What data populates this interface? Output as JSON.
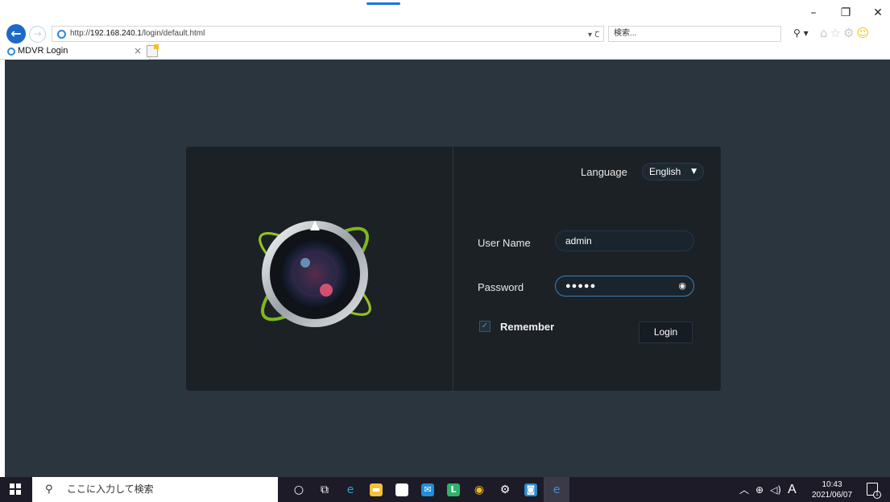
{
  "browser": {
    "window_controls": [
      "–",
      "❐",
      "✕"
    ],
    "back_glyph": "←",
    "forward_glyph": "→",
    "address": {
      "prefix": "http://",
      "host": "192.168.240.1",
      "path": "/login/default.html"
    },
    "address_controls": "▾ Ꞇ",
    "search_placeholder": "検索...",
    "search_icon": "⚲ ▾",
    "toolbar_icons": [
      "⌂",
      "☆",
      "⚙",
      "☺"
    ],
    "tab": {
      "title": "MDVR Login",
      "close": "×"
    }
  },
  "login": {
    "language_label": "Language",
    "language_value": "English",
    "language_caret": "▼",
    "username_label": "User Name",
    "username_value": "admin",
    "password_label": "Password",
    "password_value": "●●●●●",
    "show_password_icon": "eye-icon",
    "remember_label": "Remember",
    "remember_checked": true,
    "remember_check_glyph": "✓",
    "login_label": "Login"
  },
  "taskbar": {
    "search_placeholder": "ここに入力して検索",
    "search_glyph": "⚲",
    "apps": [
      {
        "name": "cortana",
        "glyph": "○",
        "color": "#ffffff"
      },
      {
        "name": "task-view",
        "glyph": "⧉",
        "color": "#ffffff"
      },
      {
        "name": "edge",
        "glyph": "e",
        "color": "#1fa7e0"
      },
      {
        "name": "file-explorer",
        "glyph": "▬",
        "color": "#f3c13a"
      },
      {
        "name": "store",
        "glyph": "⛉",
        "color": "#ffffff"
      },
      {
        "name": "mail",
        "glyph": "✉",
        "color": "#1f8fd8"
      },
      {
        "name": "app-l",
        "glyph": "L",
        "color": "#2fb36b"
      },
      {
        "name": "chrome",
        "glyph": "◉",
        "color": "#f0b928"
      },
      {
        "name": "settings",
        "glyph": "⚙",
        "color": "#ffffff"
      },
      {
        "name": "camera-app",
        "glyph": "◙",
        "color": "#2a8bd0"
      },
      {
        "name": "internet-explorer",
        "glyph": "e",
        "color": "#3d8fe0"
      }
    ],
    "tray": {
      "chevron": "︿",
      "network": "⊕",
      "volume": "🔈",
      "ime": "A"
    },
    "clock": {
      "time": "10:43",
      "date": "2021/06/07"
    },
    "notification_count": "1"
  }
}
